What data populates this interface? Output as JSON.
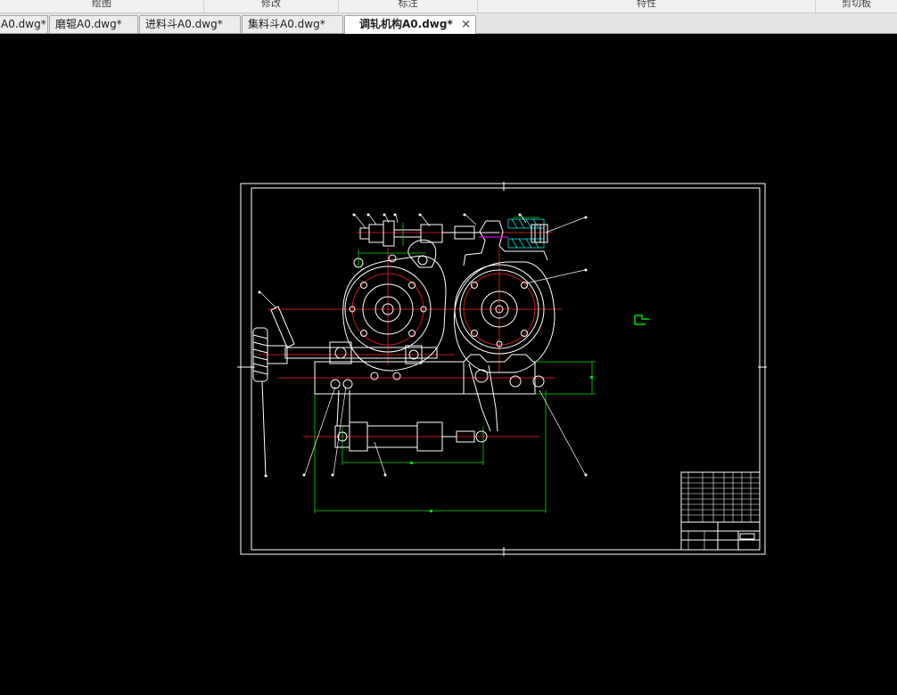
{
  "ribbon": {
    "groups": [
      {
        "label": "绘图"
      },
      {
        "label": "修改"
      },
      {
        "label": "标注"
      },
      {
        "label": "特性"
      },
      {
        "label": "剪切板"
      }
    ]
  },
  "tabs": [
    {
      "label": "A0.dwg*"
    },
    {
      "label": "磨辊A0.dwg*"
    },
    {
      "label": "进料斗A0.dwg*"
    },
    {
      "label": "集料斗A0.dwg*"
    },
    {
      "label": "调轧机构A0.dwg*",
      "active": true,
      "close": "×"
    }
  ],
  "drawing": {
    "background": "#000000",
    "line_colors": {
      "outline": "#ffffff",
      "center": "#ff2020",
      "dimension": "#00e000",
      "section": "#00e0e0",
      "hidden": "#d000d0"
    }
  }
}
